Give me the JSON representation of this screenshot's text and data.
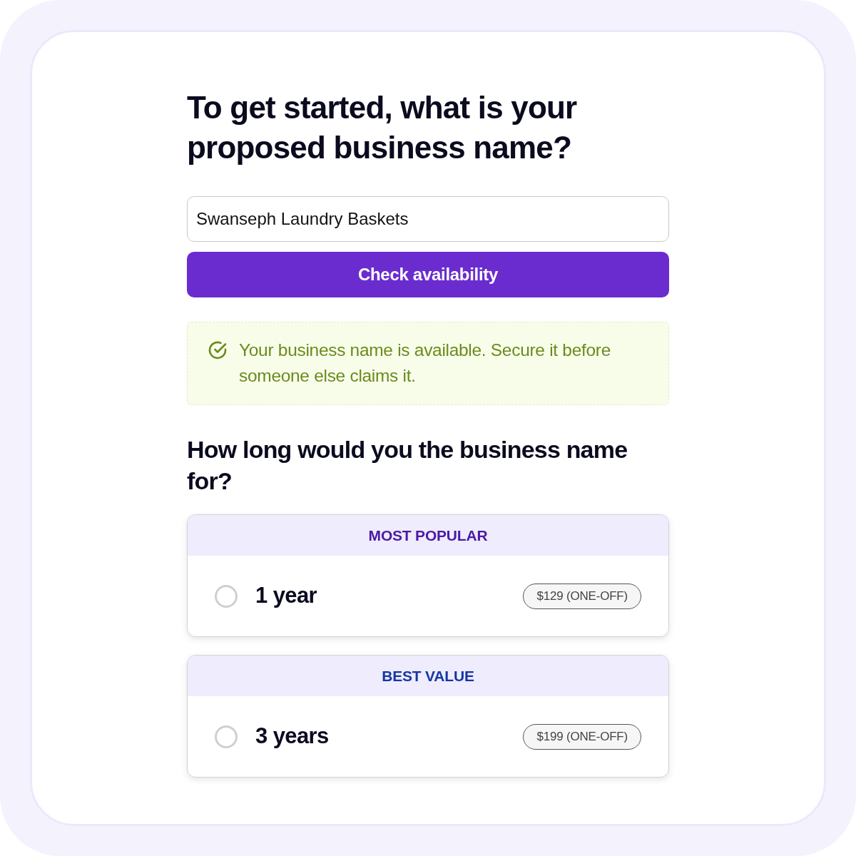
{
  "heading": "To get started, what is your proposed business name?",
  "name_field": {
    "value": "Swanseph Laundry Baskets"
  },
  "check_button": {
    "label": "Check availability"
  },
  "alert": {
    "kind": "success",
    "message": "Your business name is available. Secure it before someone else claims it."
  },
  "duration_question": "How long would you the business name for?",
  "options": [
    {
      "tag": "MOST POPULAR",
      "color": "#4a1aa6",
      "label": "1 year",
      "price": "$129 (ONE-OFF)",
      "selected": false
    },
    {
      "tag": "BEST VALUE",
      "color": "#1537a0",
      "label": "3 years",
      "price": "$199 (ONE-OFF)",
      "selected": false
    }
  ]
}
